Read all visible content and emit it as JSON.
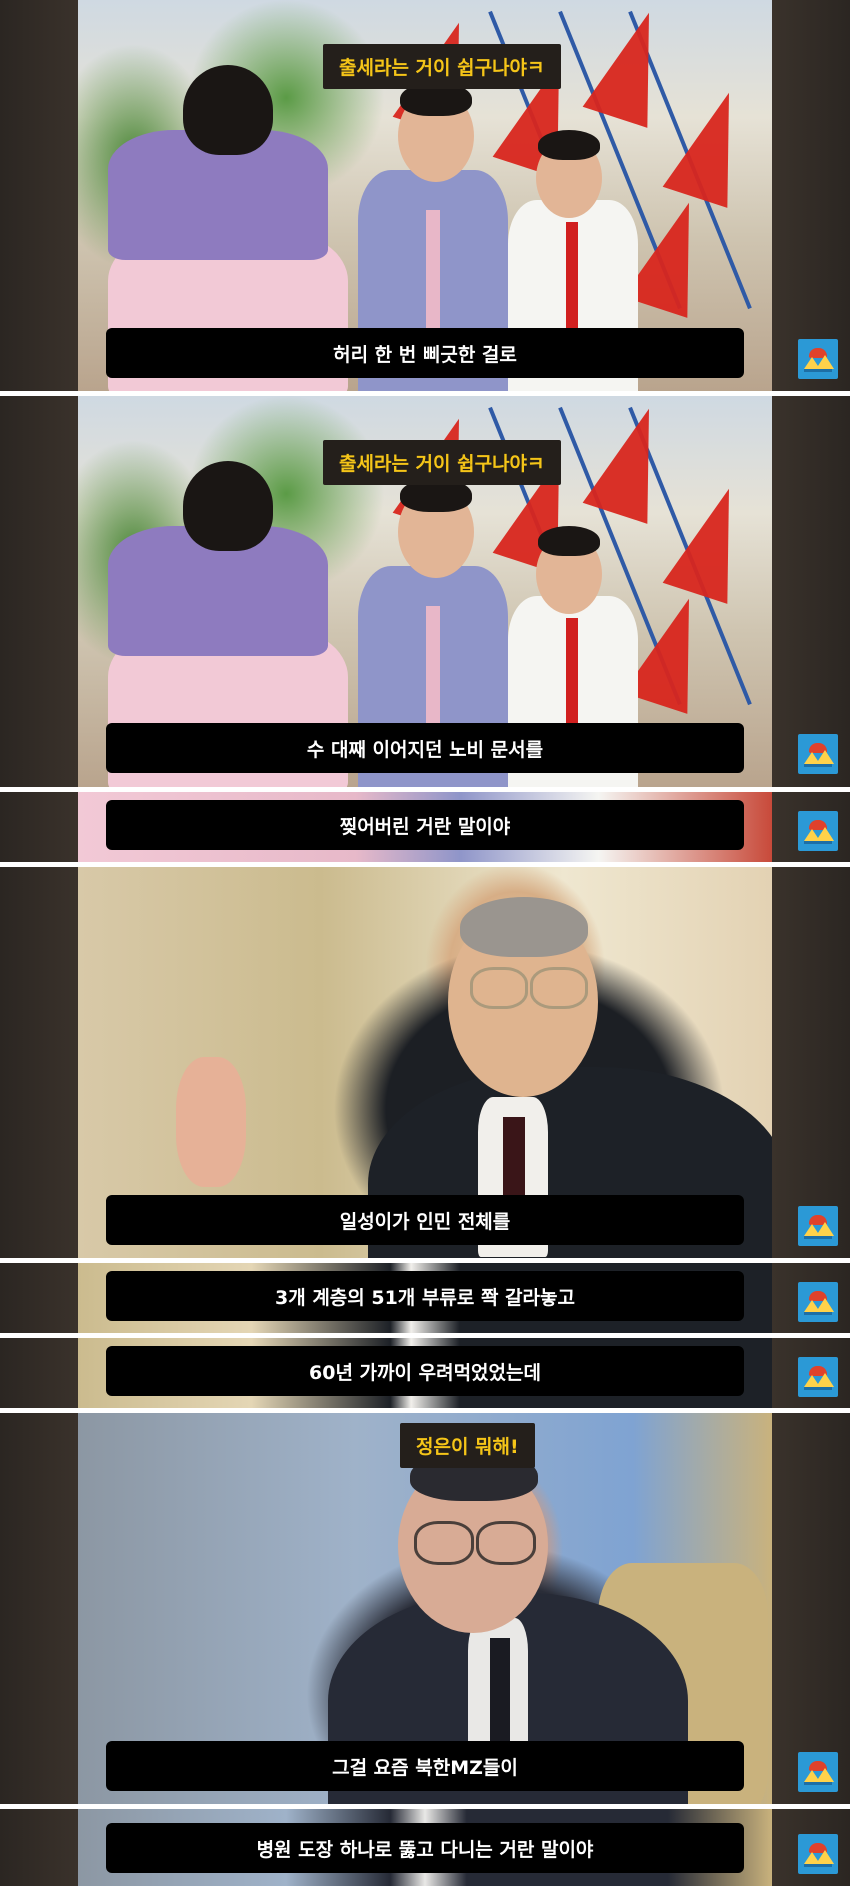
{
  "frames": [
    {
      "caption": "출세라는 거이 쉽구나야ㅋ",
      "subtitle": "허리 한 번 삐긋한 걸로"
    },
    {
      "caption": "출세라는 거이 쉽구나야ㅋ",
      "subtitle": "수 대째 이어지던 노비 문서를"
    },
    {
      "subtitle": "찢어버린 거란 말이야"
    },
    {
      "subtitle": "일성이가 인민 전체를"
    },
    {
      "subtitle": "3개 계층의 51개 부류로 쫙 갈라놓고"
    },
    {
      "subtitle": "60년 가까이 우려먹었었는데"
    },
    {
      "caption": "정은이 뭐해!",
      "subtitle": "그걸 요즘 북한MZ들이"
    },
    {
      "subtitle": "병원 도장 하나로 뚫고 다니는 거란 말이야"
    }
  ],
  "colors": {
    "caption_text": "#f5c518",
    "subtitle_bg": "#000000",
    "logo_bg": "#2b99d6"
  },
  "icons": {
    "channel_logo": "mountain-logo-icon"
  }
}
